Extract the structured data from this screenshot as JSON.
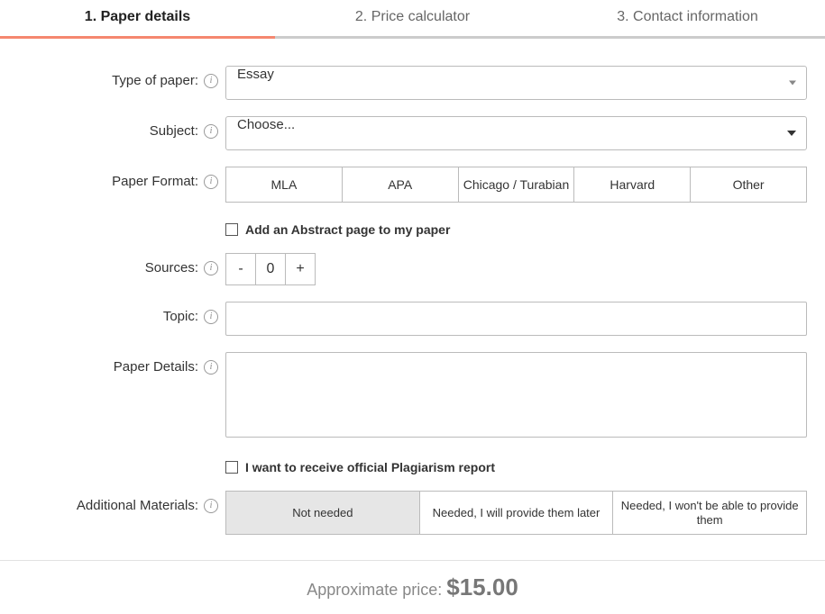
{
  "steps": {
    "s1": "1. Paper details",
    "s2": "2. Price calculator",
    "s3": "3. Contact information"
  },
  "labels": {
    "type_of_paper": "Type of paper:",
    "subject": "Subject:",
    "paper_format": "Paper Format:",
    "sources": "Sources:",
    "topic": "Topic:",
    "paper_details": "Paper Details:",
    "additional_materials": "Additional Materials:"
  },
  "type_of_paper": {
    "value": "Essay"
  },
  "subject": {
    "value": "Choose..."
  },
  "formats": {
    "f0": "MLA",
    "f1": "APA",
    "f2": "Chicago / Turabian",
    "f3": "Harvard",
    "f4": "Other"
  },
  "abstract_check": "Add an Abstract page to my paper",
  "sources": {
    "minus": "-",
    "value": "0",
    "plus": "+"
  },
  "plagiarism_check": "I want to receive official Plagiarism report",
  "materials": {
    "m0": "Not needed",
    "m1": "Needed, I will provide them later",
    "m2": "Needed, I won't be able to provide them"
  },
  "price": {
    "label": "Approximate price: ",
    "value": "$15.00"
  },
  "info_glyph": "i"
}
